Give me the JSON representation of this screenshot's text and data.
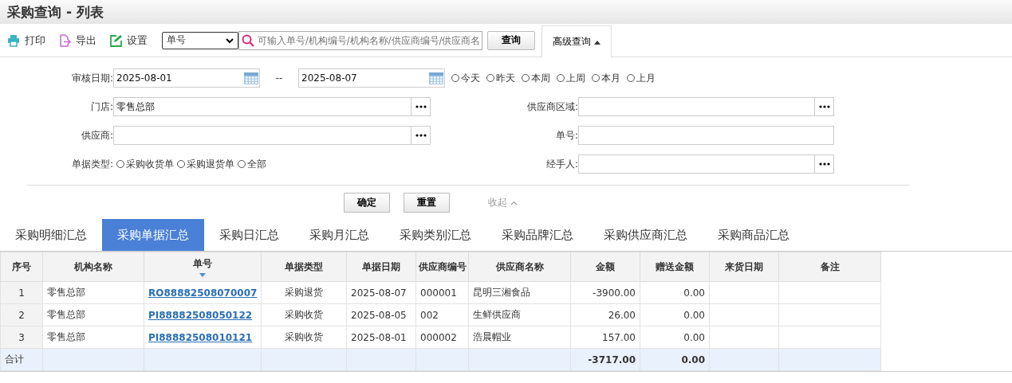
{
  "title": "采购查询 - 列表",
  "toolbar": {
    "buttons": [
      {
        "kind": "print",
        "label": "打印"
      },
      {
        "kind": "export",
        "label": "导出"
      },
      {
        "kind": "settings",
        "label": "设置"
      }
    ],
    "field_select": {
      "value": "单号"
    },
    "search": {
      "placeholder": "可输入单号/机构编号/机构名称/供应商编号/供应商名"
    },
    "query_button": "查询",
    "advanced": {
      "label": "高级查询",
      "expanded": true
    }
  },
  "filters": {
    "date_label": "审核日期:",
    "date_from": "2025-08-01",
    "separator": "--",
    "date_to": "2025-08-07",
    "date_presets": [
      {
        "label": "今天",
        "selected": false
      },
      {
        "label": "昨天",
        "selected": false
      },
      {
        "label": "本周",
        "selected": false
      },
      {
        "label": "上周",
        "selected": false
      },
      {
        "label": "本月",
        "selected": false
      },
      {
        "label": "上月",
        "selected": false
      }
    ],
    "left_fields": [
      {
        "label": "门店:",
        "value": "零售总部",
        "picker": true
      },
      {
        "label": "供应商:",
        "picker": true
      }
    ],
    "right_fields": [
      {
        "label": "供应商区域:",
        "picker": true
      },
      {
        "label": "单号:",
        "picker": false
      },
      {
        "label": "经手人:",
        "picker": true
      }
    ],
    "doc_type": {
      "label": "单据类型:",
      "options": [
        {
          "label": "采购收货单",
          "selected": false
        },
        {
          "label": "采购退货单",
          "selected": false
        },
        {
          "label": "全部",
          "selected": false
        }
      ]
    },
    "confirm": "确定",
    "reset": "重置",
    "collapse": "收起"
  },
  "tabs": [
    {
      "label": "采购明细汇总",
      "selected": false
    },
    {
      "label": "采购单据汇总",
      "selected": true
    },
    {
      "label": "采购日汇总",
      "selected": false
    },
    {
      "label": "采购月汇总",
      "selected": false
    },
    {
      "label": "采购类别汇总",
      "selected": false
    },
    {
      "label": "采购品牌汇总",
      "selected": false
    },
    {
      "label": "采购供应商汇总",
      "selected": false
    },
    {
      "label": "采购商品汇总",
      "selected": false
    }
  ],
  "table": {
    "columns": [
      {
        "label": "序号",
        "kind": "index"
      },
      {
        "label": "机构名称",
        "kind": "text"
      },
      {
        "label": "单号",
        "kind": "link",
        "sorted": true
      },
      {
        "label": "单据类型",
        "kind": "center"
      },
      {
        "label": "单据日期",
        "kind": "text"
      },
      {
        "label": "供应商编号",
        "kind": "text"
      },
      {
        "label": "供应商名称",
        "kind": "text"
      },
      {
        "label": "金额",
        "kind": "amount"
      },
      {
        "label": "赠送金额",
        "kind": "gift"
      },
      {
        "label": "来货日期",
        "kind": "text"
      },
      {
        "label": "备注",
        "kind": "text"
      }
    ],
    "rows": [
      {
        "cells": [
          "1",
          "零售总部",
          "RO88882508070007",
          "采购退货",
          "2025-08-07",
          "000001",
          "昆明三湘食品",
          "-3900.00",
          "0.00"
        ]
      },
      {
        "cells": [
          "2",
          "零售总部",
          "PI88882508050122",
          "采购收货",
          "2025-08-05",
          "002",
          "生鲜供应商",
          "26.00",
          "0.00"
        ]
      },
      {
        "cells": [
          "3",
          "零售总部",
          "PI88882508010121",
          "采购收货",
          "2025-08-01",
          "000002",
          "浩晨帽业",
          "157.00",
          "0.00"
        ]
      }
    ],
    "total": {
      "label": "合计",
      "amount": "-3717.00",
      "gift": "0.00"
    }
  }
}
